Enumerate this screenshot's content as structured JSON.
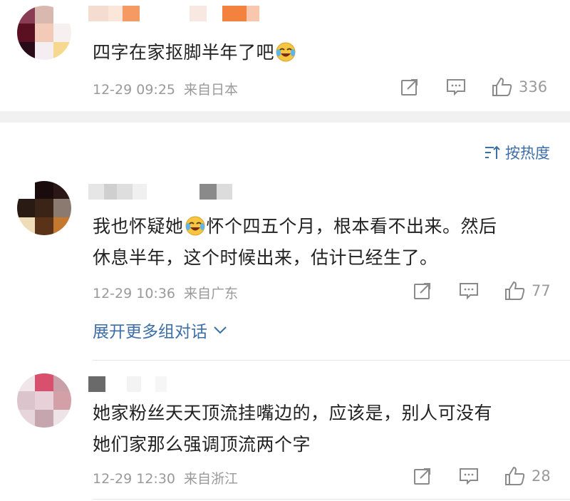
{
  "comments": [
    {
      "text_parts": [
        "四字在家抠脚半年了吧",
        ""
      ],
      "time": "12-29 09:25",
      "location": "来自日本",
      "likes": "336"
    },
    {
      "text_line1_a": "我也怀疑她",
      "text_line1_b": "怀个四五个月，根本看不出来。然后",
      "text_line2": "休息半年，这个时候出来，估计已经生了。",
      "time": "12-29 10:36",
      "location": "来自广东",
      "likes": "77",
      "expand_label": "展开更多组对话"
    },
    {
      "text_line1": "她家粉丝天天顶流挂嘴边的，应该是，别人可没有",
      "text_line2": "她们家那么强调顶流两个字",
      "time": "12-29 12:30",
      "location": "来自浙江",
      "likes": "28"
    }
  ],
  "sort": {
    "label": "按热度"
  },
  "icons": {
    "share": "share-icon",
    "comment": "comment-icon",
    "like": "like-icon",
    "sort": "sort-icon",
    "emoji": "laughing-tears-emoji-icon",
    "chevron": "chevron-down-icon"
  },
  "colors": {
    "link": "#3c6ea8",
    "meta": "#9a9a9a",
    "band": "#f1f1f1"
  }
}
